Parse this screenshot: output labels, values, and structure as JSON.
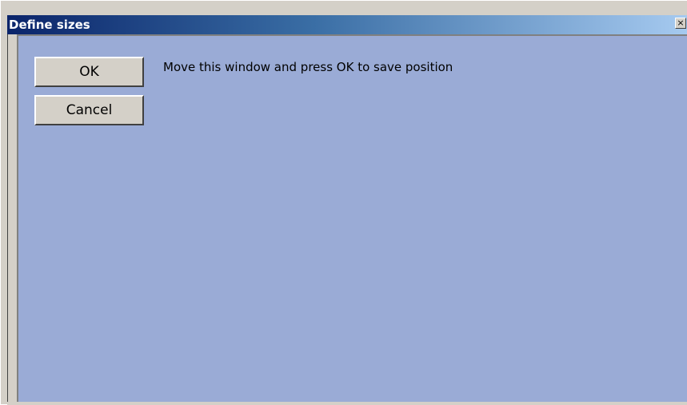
{
  "window": {
    "title": "Define sizes",
    "close_glyph": "×",
    "close_icon": "close-icon"
  },
  "buttons": {
    "ok_label": "OK",
    "cancel_label": "Cancel"
  },
  "message": "Move this window and press OK to save position",
  "colors": {
    "client_background": "#9aabd6",
    "title_gradient_start": "#0a246a",
    "title_gradient_end": "#a6caf0",
    "button_face": "#d4d0c8"
  }
}
